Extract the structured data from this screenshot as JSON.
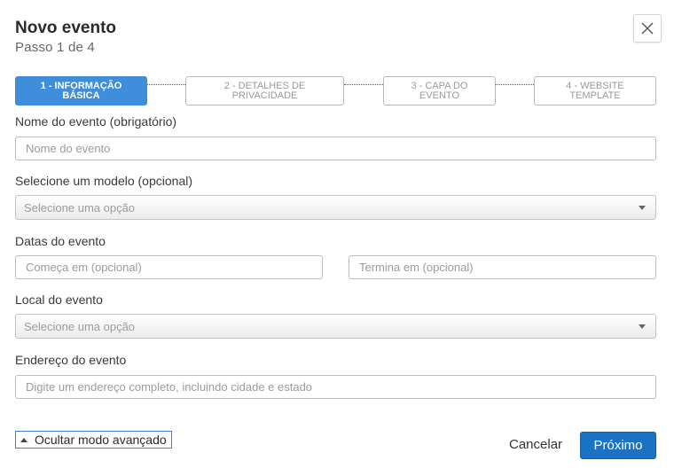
{
  "header": {
    "title": "Novo evento",
    "subtitle": "Passo 1 de 4"
  },
  "steps": [
    {
      "label": "1 - INFORMAÇÃO\nBÁSICA",
      "active": true
    },
    {
      "label": "2 - DETALHES DE\nPRIVACIDADE",
      "active": false
    },
    {
      "label": "3 - CAPA DO\nEVENTO",
      "active": false
    },
    {
      "label": "4 - WEBSITE\nTEMPLATE",
      "active": false
    }
  ],
  "form": {
    "event_name": {
      "label": "Nome do evento (obrigatório)",
      "placeholder": "Nome do evento",
      "value": ""
    },
    "template": {
      "label": "Selecione um modelo (opcional)",
      "placeholder": "Selecione uma opção"
    },
    "dates": {
      "label": "Datas do evento",
      "start_placeholder": "Começa em (opcional)",
      "end_placeholder": "Termina em (opcional)"
    },
    "location": {
      "label": "Local do evento",
      "placeholder": "Selecione uma opção"
    },
    "address": {
      "label": "Endereço do evento",
      "placeholder": "Digite um endereço completo, incluindo cidade e estado",
      "value": ""
    }
  },
  "footer": {
    "advanced_toggle": "Ocultar modo avançado",
    "cancel": "Cancelar",
    "next": "Próximo"
  },
  "colors": {
    "primary": "#1a72c5",
    "step_active": "#3f8edc"
  },
  "icons": {
    "close": "close-icon",
    "caret": "chevron-down-icon",
    "toggle": "caret-up-icon"
  }
}
